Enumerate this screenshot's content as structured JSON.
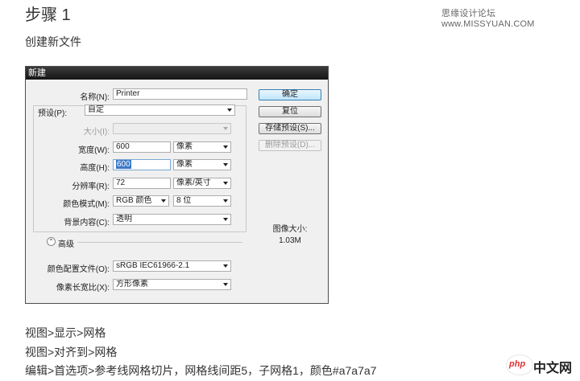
{
  "page": {
    "step_title": "步骤 1",
    "watermark": "思缘设计论坛 www.MISSYUAN.COM",
    "subtitle": "创建新文件",
    "instructions": [
      "视图>显示>网格",
      "视图>对齐到>网格",
      "编辑>首选项>参考线网格切片，网格线间距5，子网格1，颜色#a7a7a7"
    ],
    "logo_text": "php",
    "logo_cn": "中文网"
  },
  "dialog": {
    "title": "新建",
    "name_label": "名称(N):",
    "name_value": "Printer",
    "preset_label": "预设(P):",
    "preset_value": "自定",
    "size_label": "大小(I):",
    "width_label": "宽度(W):",
    "width_value": "600",
    "width_unit": "像素",
    "height_label": "高度(H):",
    "height_value": "600",
    "height_unit": "像素",
    "resolution_label": "分辨率(R):",
    "resolution_value": "72",
    "resolution_unit": "像素/英寸",
    "color_mode_label": "颜色模式(M):",
    "color_mode_value": "RGB 颜色",
    "bit_depth_value": "8 位",
    "background_label": "背景内容(C):",
    "background_value": "透明",
    "advanced_label": "高级",
    "color_profile_label": "颜色配置文件(O):",
    "color_profile_value": "sRGB IEC61966-2.1",
    "pixel_aspect_label": "像素长宽比(X):",
    "pixel_aspect_value": "方形像素",
    "buttons": {
      "ok": "确定",
      "reset": "复位",
      "save_preset": "存储预设(S)...",
      "delete_preset": "删除预设(D)..."
    },
    "image_size_label": "图像大小:",
    "image_size_value": "1.03M"
  }
}
